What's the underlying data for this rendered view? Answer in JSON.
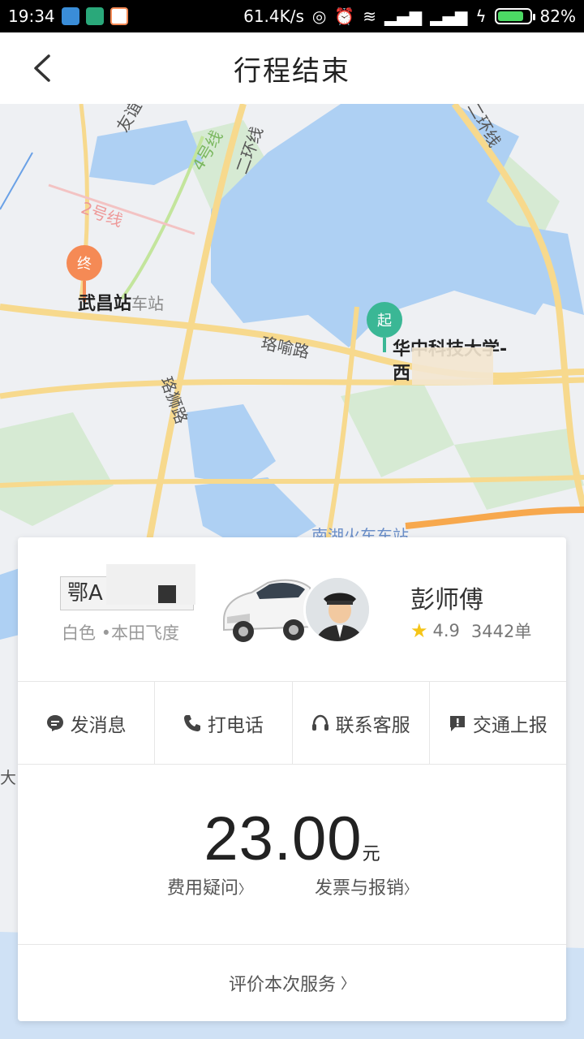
{
  "status_bar": {
    "time": "19:34",
    "network_speed": "61.4K/s",
    "battery_percent": "82%",
    "battery_level": 0.82
  },
  "header": {
    "title": "行程结束"
  },
  "map": {
    "labels": {
      "wuchang_station": "武昌站",
      "wuchang_station_suffix": "车站",
      "huazhong_univ_line1": "华中科技大学-",
      "huazhong_univ_line2": "西",
      "luoyu_road": "珞喻路",
      "luoshi_road": "珞狮路",
      "second_ring": "二环线",
      "second_ring_right": "二环线",
      "line4": "4号线",
      "line2": "2号线",
      "nanhu_station": "南湖火车东站",
      "youyi": "友谊",
      "da": "大"
    },
    "pins": {
      "end": "终",
      "start": "起"
    }
  },
  "driver": {
    "plate": "鄂A",
    "car_description": "白色 •本田飞度",
    "name": "彭师傅",
    "rating": "4.9",
    "orders": "3442单"
  },
  "actions": [
    {
      "label": "发消息",
      "icon": "message-icon"
    },
    {
      "label": "打电话",
      "icon": "phone-icon"
    },
    {
      "label": "联系客服",
      "icon": "headset-icon"
    },
    {
      "label": "交通上报",
      "icon": "report-icon"
    }
  ],
  "fare": {
    "amount": "23.00",
    "unit": "元",
    "question_link": "费用疑问",
    "invoice_link": "发票与报销",
    "link_arrow": "〉"
  },
  "evaluate": {
    "label": "评价本次服务",
    "arrow": "〉"
  },
  "colors": {
    "water": "#aed0f3",
    "green": "#cfe8cf",
    "road": "#f7d98d",
    "end_pin": "#f58a55",
    "start_pin": "#3ab795"
  }
}
